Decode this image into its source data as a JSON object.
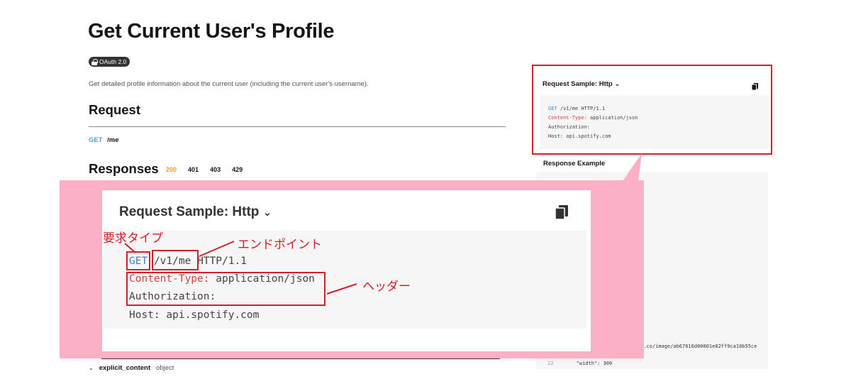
{
  "page": {
    "title": "Get Current User's Profile",
    "badge": "OAuth 2.0",
    "description": "Get detailed profile information about the current user (including the current user's username)."
  },
  "request": {
    "title": "Request",
    "method": "GET",
    "path": "/me"
  },
  "responses": {
    "title": "Responses",
    "codes": [
      "200",
      "401",
      "403",
      "429"
    ],
    "active_code": "200"
  },
  "field": {
    "name": "explicit_content",
    "type": "object"
  },
  "request_sample": {
    "title": "Request Sample: Http",
    "lines": {
      "method": "GET",
      "path": "/v1/me",
      "protocol": "HTTP/1.1",
      "content_type_key": "Content-Type:",
      "content_type_val": "application/json",
      "authorization_key": "Authorization:",
      "host_key": "Host:",
      "host_val": "api.spotify.com"
    }
  },
  "response_example": {
    "title": "Response Example",
    "url_fragment": "n.co/image/ab67616d00001e02ff9ca10b55ce",
    "line_number": "22",
    "line_text": "\"width\": 300"
  },
  "annotations": {
    "request_type": "要求タイプ",
    "endpoint": "エンドポイント",
    "header": "ヘッダー"
  },
  "colors": {
    "annotation_red": "#d3202a",
    "callout_pink": "#fbb0c6",
    "method_blue": "#4aa3df",
    "active_orange": "#f59b23"
  }
}
